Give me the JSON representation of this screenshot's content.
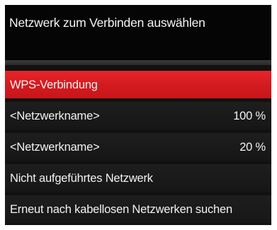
{
  "header": {
    "title": "Netzwerk zum Verbinden auswählen"
  },
  "list": {
    "items": [
      {
        "label": "WPS-Verbindung",
        "value": "",
        "selected": true
      },
      {
        "label": "<Netzwerkname>",
        "value": "100 %",
        "selected": false
      },
      {
        "label": "<Netzwerkname>",
        "value": "20 %",
        "selected": false
      },
      {
        "label": "Nicht aufgeführtes Netzwerk",
        "value": "",
        "selected": false
      },
      {
        "label": "Erneut nach kabellosen Netzwerken suchen",
        "value": "",
        "selected": false
      }
    ]
  },
  "colors": {
    "selected_row": "#d81c21",
    "row_background": "#1a1a1a",
    "panel_background": "#050505",
    "text": "#f2f2f2"
  }
}
